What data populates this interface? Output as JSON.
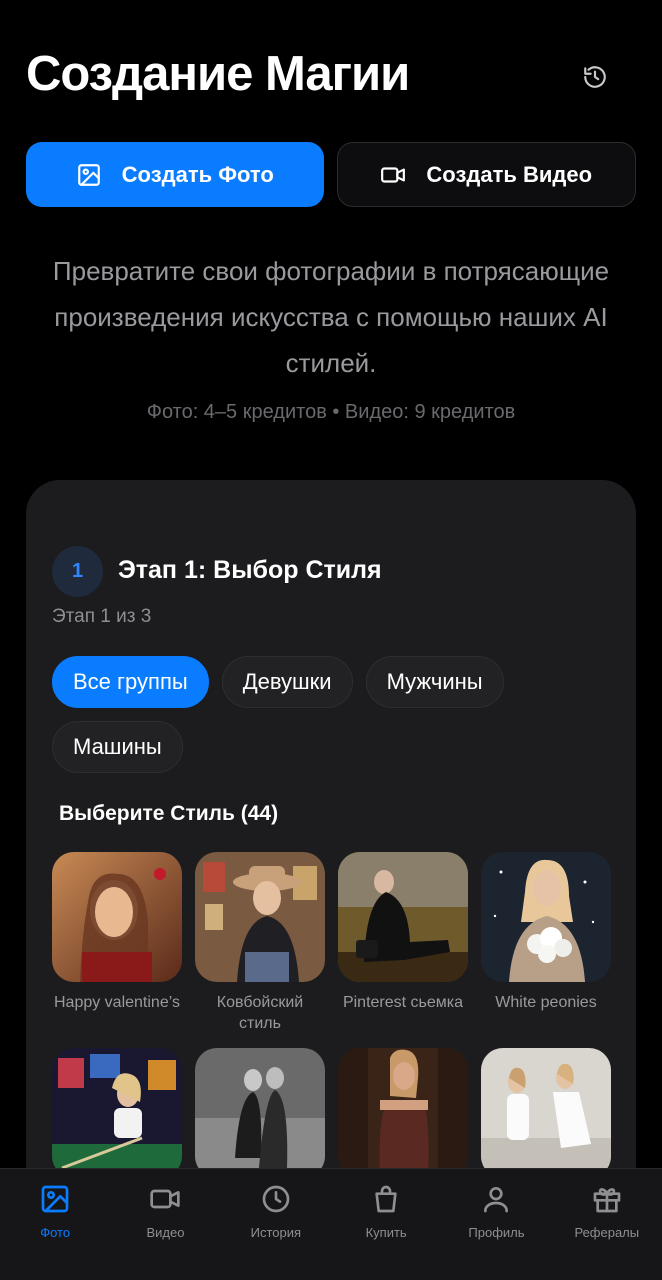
{
  "header": {
    "title": "Создание Магии",
    "history_icon": "history-icon"
  },
  "modes": [
    {
      "label": "Создать Фото",
      "icon": "image-icon",
      "active": true
    },
    {
      "label": "Создать Видео",
      "icon": "video-camera-icon",
      "active": false
    }
  ],
  "intro": {
    "text": "Превратите свои фотографии в потрясающие произведения искусства с помощью наших AI стилей.",
    "credits": "Фото: 4–5 кредитов • Видео: 9 кредитов"
  },
  "step": {
    "number": "1",
    "title": "Этап 1: Выбор Стиля",
    "progress": "Этап 1 из 3"
  },
  "filters": [
    {
      "label": "Все группы",
      "active": true
    },
    {
      "label": "Девушки",
      "active": false
    },
    {
      "label": "Мужчины",
      "active": false
    },
    {
      "label": "Машины",
      "active": false
    }
  ],
  "styles": {
    "title": "Выберите Стиль (44)",
    "items": [
      {
        "label": "Happy valentine’s"
      },
      {
        "label": "Ковбойский стиль"
      },
      {
        "label": "Pinterest сьемка"
      },
      {
        "label": "White peonies"
      },
      {
        "label": ""
      },
      {
        "label": ""
      },
      {
        "label": ""
      },
      {
        "label": ""
      }
    ]
  },
  "nav": [
    {
      "label": "Фото",
      "icon": "image-icon",
      "active": true
    },
    {
      "label": "Видео",
      "icon": "video-icon",
      "active": false
    },
    {
      "label": "История",
      "icon": "clock-icon",
      "active": false
    },
    {
      "label": "Купить",
      "icon": "shopping-bag-icon",
      "active": false
    },
    {
      "label": "Профиль",
      "icon": "user-icon",
      "active": false
    },
    {
      "label": "Рефералы",
      "icon": "gift-icon",
      "active": false
    }
  ],
  "colors": {
    "accent": "#0a7cff",
    "background": "#000000",
    "card": "#1c1c1e"
  }
}
